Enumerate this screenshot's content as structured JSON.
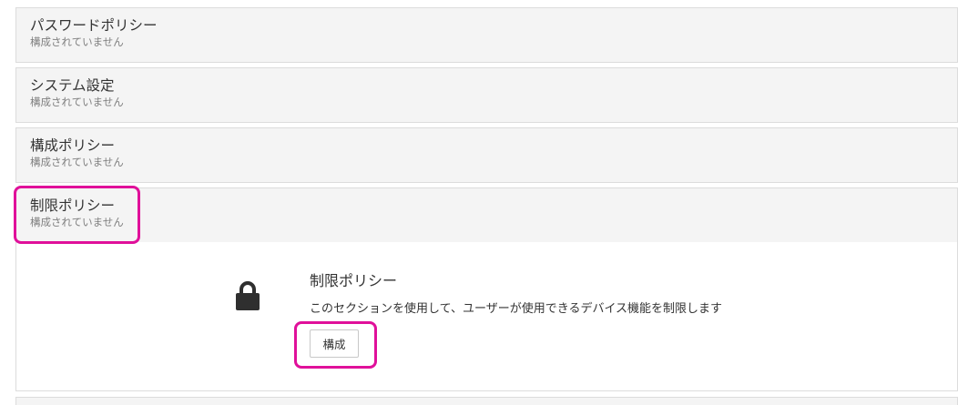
{
  "sections": [
    {
      "title": "パスワードポリシー",
      "status": "構成されていません"
    },
    {
      "title": "システム設定",
      "status": "構成されていません"
    },
    {
      "title": "構成ポリシー",
      "status": "構成されていません"
    },
    {
      "title": "制限ポリシー",
      "status": "構成されていません"
    }
  ],
  "expanded": {
    "icon": "lock-icon",
    "title": "制限ポリシー",
    "description": "このセクションを使用して、ユーザーが使用できるデバイス機能を制限します",
    "button_label": "構成"
  },
  "colors": {
    "highlight": "#e0109a",
    "section_bg": "#f4f4f4",
    "border": "#dcdcdc"
  }
}
